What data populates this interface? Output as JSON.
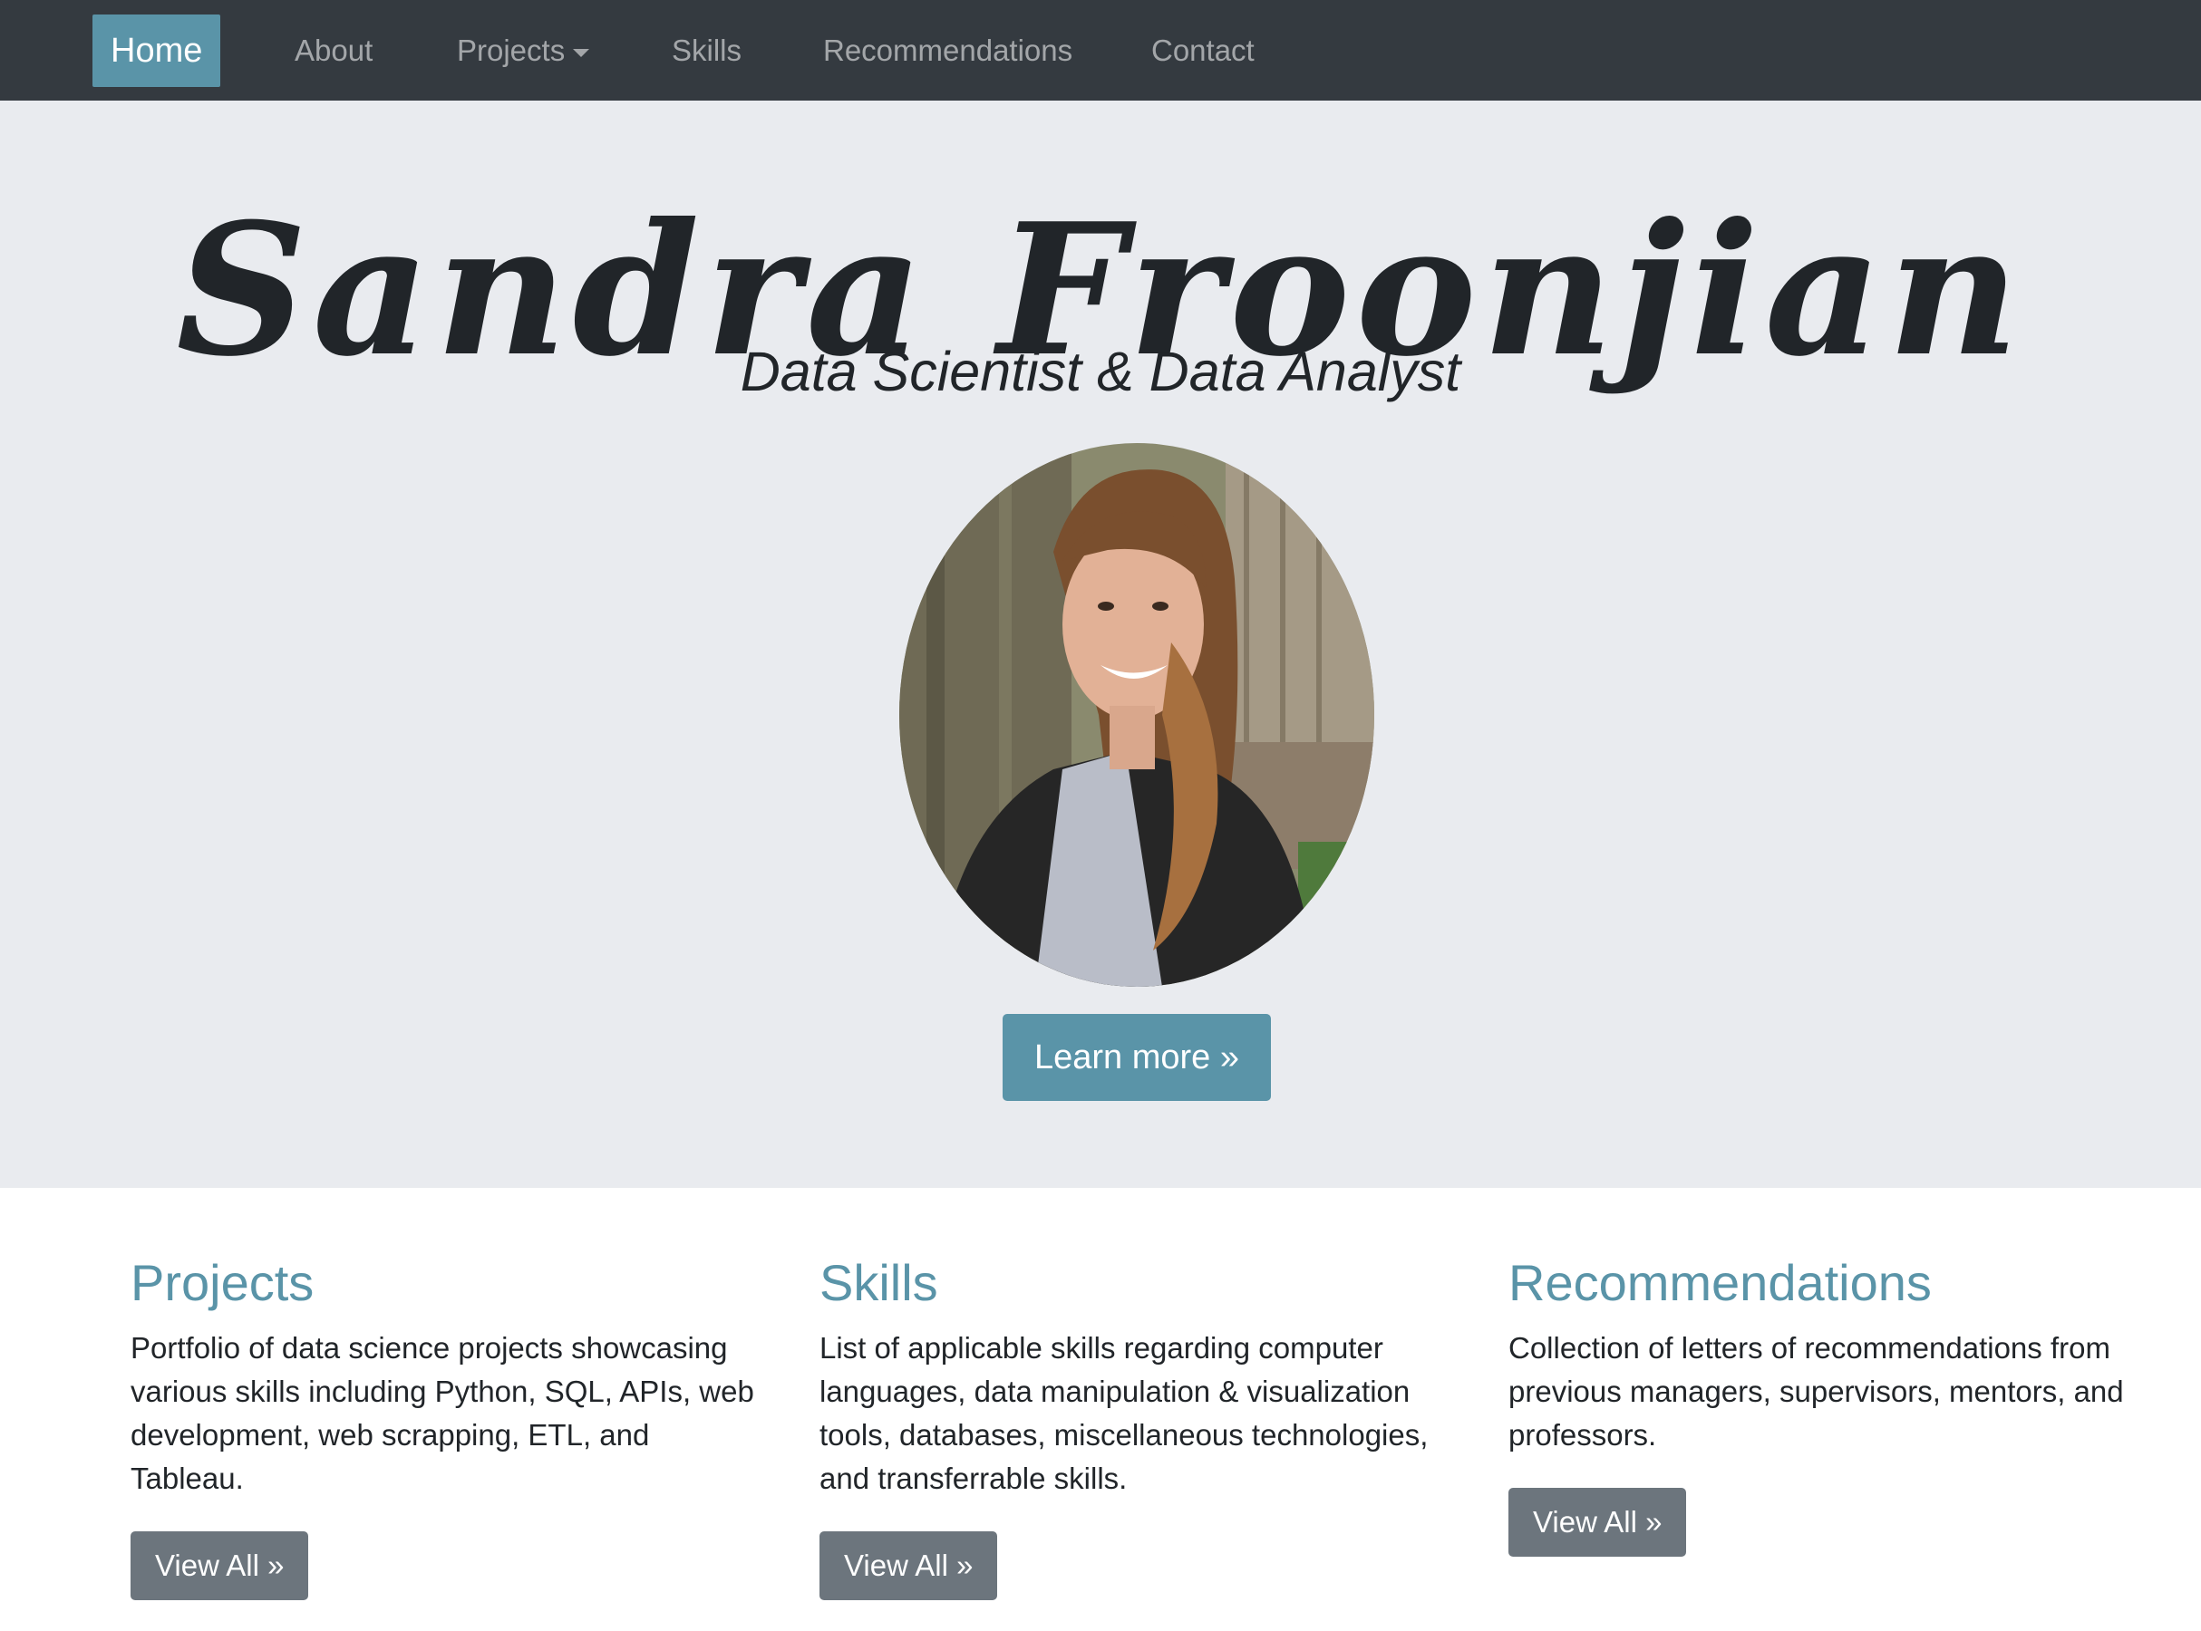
{
  "nav": {
    "items": [
      {
        "label": "Home"
      },
      {
        "label": "About"
      },
      {
        "label": "Projects"
      },
      {
        "label": "Skills"
      },
      {
        "label": "Recommendations"
      },
      {
        "label": "Contact"
      }
    ]
  },
  "hero": {
    "name": "Sandra Froonjian",
    "subtitle": "Data Scientist & Data Analyst",
    "cta_label": "Learn more »"
  },
  "sections": [
    {
      "title": "Projects",
      "text": "Portfolio of data science projects showcasing various skills including Python, SQL, APIs, web development, web scrapping, ETL, and Tableau.",
      "button_label": "View All »"
    },
    {
      "title": "Skills",
      "text": "List of applicable skills regarding computer languages, data manipulation & visualization tools, databases, miscellaneous technologies, and transferrable skills.",
      "button_label": "View All »"
    },
    {
      "title": "Recommendations",
      "text": "Collection of letters of recommendations from previous managers, supervisors, mentors, and professors.",
      "button_label": "View All »"
    }
  ],
  "colors": {
    "navbar": "#343a40",
    "accent": "#5a94a8",
    "jumbotron": "#e9ebef",
    "secondary_button": "#6c757d"
  }
}
